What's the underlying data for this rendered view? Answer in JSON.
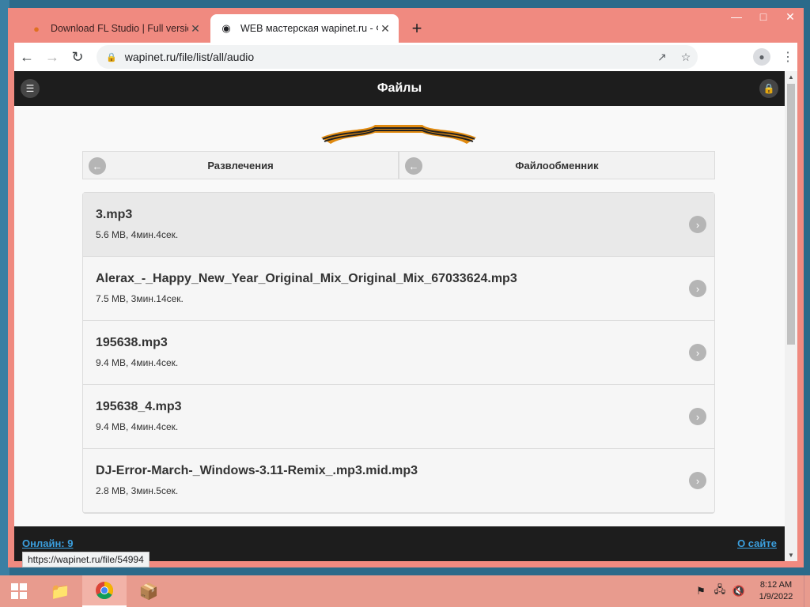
{
  "browser": {
    "tabs": [
      {
        "title": "Download FL Studio | Full version",
        "favicon": "fl-studio-icon",
        "active": false
      },
      {
        "title": "WEB мастерская wapinet.ru - Фа",
        "favicon": "eye-icon",
        "active": true
      }
    ],
    "new_tab_label": "+",
    "url": "wapinet.ru/file/list/all/audio",
    "status_url": "https://wapinet.ru/file/54994"
  },
  "site": {
    "title": "Файлы",
    "breadcrumbs": [
      {
        "label": "Развлечения"
      },
      {
        "label": "Файлообменник"
      }
    ],
    "files": [
      {
        "name": "3.mp3",
        "meta": "5.6 MB, 4мин.4сек.",
        "highlight": true
      },
      {
        "name": "Alerax_-_Happy_New_Year_Original_Mix_Original_Mix_67033624.mp3",
        "meta": "7.5 MB, 3мин.14сек.",
        "highlight": false
      },
      {
        "name": "195638.mp3",
        "meta": "9.4 MB, 4мин.4сек.",
        "highlight": false
      },
      {
        "name": "195638_4.mp3",
        "meta": "9.4 MB, 4мин.4сек.",
        "highlight": false
      },
      {
        "name": "DJ-Error-March-_Windows-3.11-Remix_.mp3.mid.mp3",
        "meta": "2.8 MB, 3мин.5сек.",
        "highlight": false
      }
    ],
    "footer_left": "Онлайн: 9",
    "footer_right": "О сайте"
  },
  "taskbar": {
    "time": "8:12 AM",
    "date": "1/9/2022"
  },
  "colors": {
    "window_frame": "#f08a80",
    "header_bg": "#1d1d1d",
    "link": "#3ba0e0"
  }
}
